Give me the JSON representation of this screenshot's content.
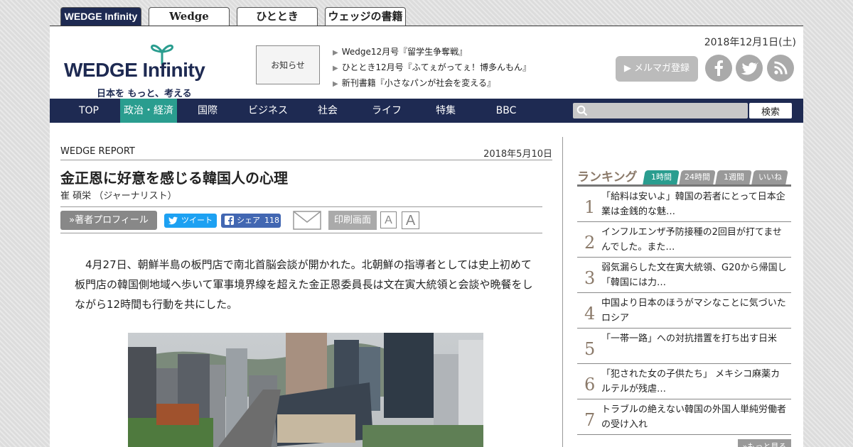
{
  "site_tabs": [
    {
      "label": "WEDGE Infinity",
      "active": true
    },
    {
      "label": "Wedge"
    },
    {
      "label": "ひととき"
    },
    {
      "label": "ウェッジの書籍"
    }
  ],
  "header": {
    "logo_main": "WEDGE Infinity",
    "logo_sub": "日本を もっと、考える",
    "notice": "お知らせ",
    "news": [
      "Wedge12月号『留学生争奪戦』",
      "ひととき12月号『ふてぇがってぇ！博多んもん』",
      "新刊書籍『小さなパンが社会を変える』"
    ],
    "date": "2018年12月1日(土)",
    "mail_button": "▶ メルマガ登録",
    "social_icons": [
      "facebook-icon",
      "twitter-icon",
      "rss-icon"
    ]
  },
  "nav": {
    "items": [
      "TOP",
      "政治・経済",
      "国際",
      "ビジネス",
      "社会",
      "ライフ",
      "特集",
      "BBC"
    ],
    "active_index": 1,
    "search_placeholder": "",
    "search_button": "検索"
  },
  "article": {
    "section": "WEDGE REPORT",
    "date": "2018年5月10日",
    "title": "金正恩に好意を感じる韓国人の心理",
    "author": "崔 碩栄 （ジャーナリスト）",
    "profile_button": "»著者プロフィール",
    "tweet": "ツイート",
    "share": "シェア",
    "share_count": "118",
    "print": "印刷画面",
    "font_small": "A",
    "font_large": "A",
    "body": "4月27日、朝鮮半島の板門店で南北首脳会談が開かれた。北朝鮮の指導者としては史上初めて板門店の韓国側地域へ歩いて軍事境界線を超えた金正恩委員長は文在寅大統領と会談や晩餐をしながら12時間も行動を共にした。"
  },
  "ranking": {
    "title": "ランキング",
    "tabs": [
      "1時間",
      "24時間",
      "1週間",
      "いいね"
    ],
    "active_tab": 0,
    "items": [
      {
        "num": "1",
        "text": "「給料は安いよ」韓国の若者にとって日本企業は金銭的な魅…"
      },
      {
        "num": "2",
        "text": "インフルエンザ予防接種の2回目が打てませんでした。また…"
      },
      {
        "num": "3",
        "text": "弱気漏らした文在寅大統領、G20から帰国し「韓国には力…"
      },
      {
        "num": "4",
        "text": "中国より日本のほうがマシなことに気づいたロシア"
      },
      {
        "num": "5",
        "text": "「一帯一路」への対抗措置を打ち出す日米"
      },
      {
        "num": "6",
        "text": "「犯された女の子供たち」 メキシコ麻薬カルテルが残虐…"
      },
      {
        "num": "7",
        "text": "トラブルの絶えない韓国の外国人単純労働者の受け入れ"
      }
    ],
    "more": "»もっと見る"
  },
  "colors": {
    "navy": "#1e2a52",
    "teal_active": "#2a9d8f",
    "ranking_accent": "#8b7a6a"
  }
}
